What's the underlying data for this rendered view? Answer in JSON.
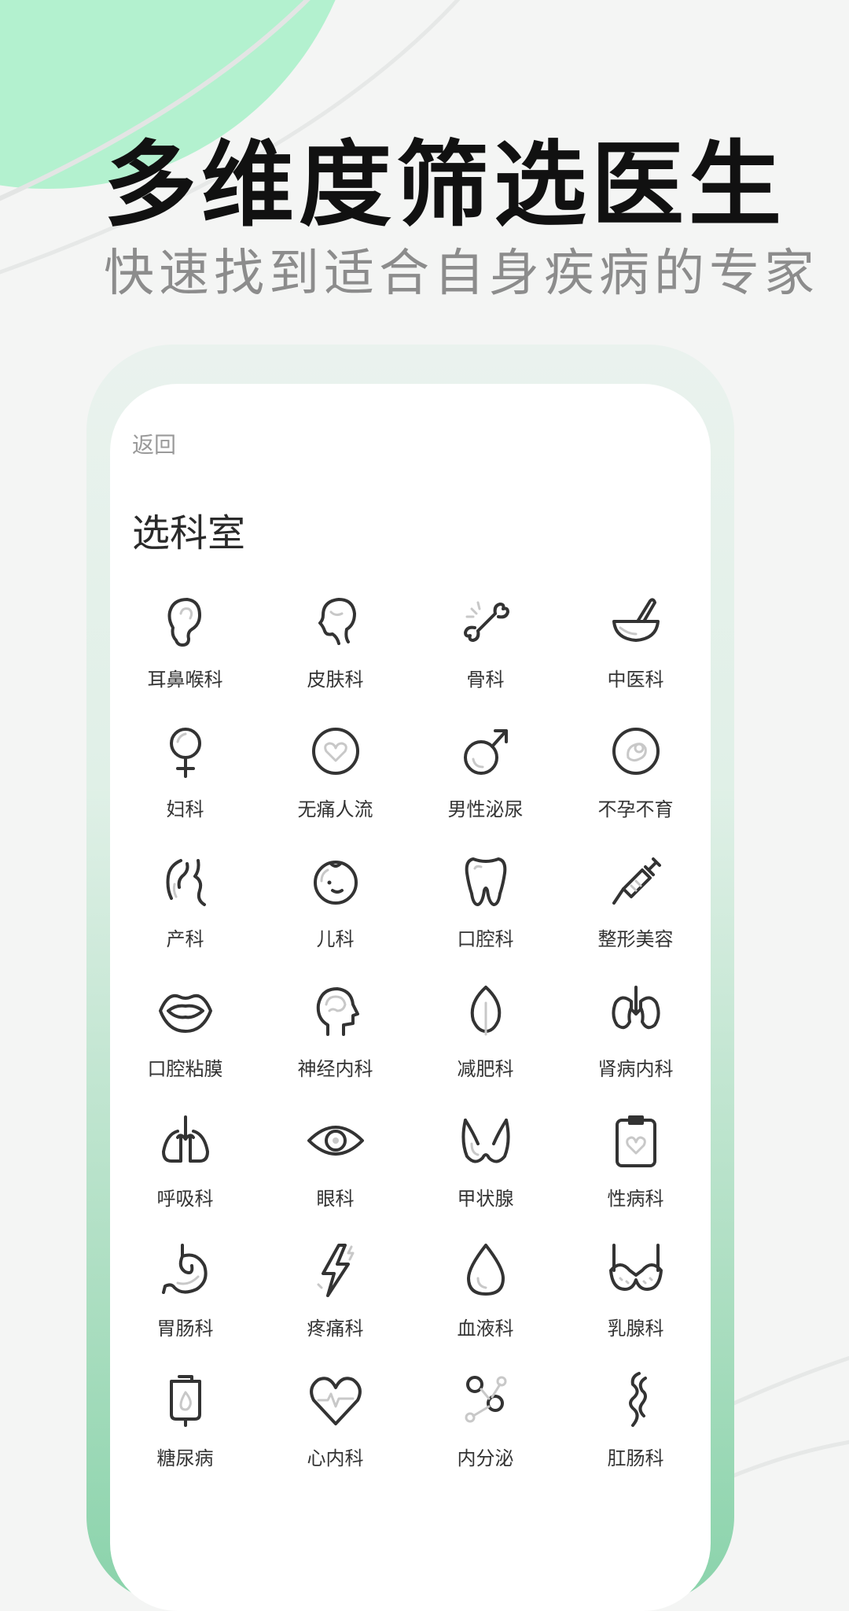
{
  "headline": "多维度筛选医生",
  "subline": "快速找到适合自身疾病的专家",
  "phone": {
    "back_label": "返回",
    "title": "选科室"
  },
  "departments": [
    {
      "label": "耳鼻喉科",
      "icon": "ear-icon"
    },
    {
      "label": "皮肤科",
      "icon": "face-profile-icon"
    },
    {
      "label": "骨科",
      "icon": "bone-icon"
    },
    {
      "label": "中医科",
      "icon": "mortar-pestle-icon"
    },
    {
      "label": "妇科",
      "icon": "female-symbol-icon"
    },
    {
      "label": "无痛人流",
      "icon": "heart-circle-icon"
    },
    {
      "label": "男性泌尿",
      "icon": "male-symbol-icon"
    },
    {
      "label": "不孕不育",
      "icon": "baby-circle-icon"
    },
    {
      "label": "产科",
      "icon": "pregnancy-icon"
    },
    {
      "label": "儿科",
      "icon": "baby-face-icon"
    },
    {
      "label": "口腔科",
      "icon": "tooth-icon"
    },
    {
      "label": "整形美容",
      "icon": "syringe-icon"
    },
    {
      "label": "口腔粘膜",
      "icon": "lips-icon"
    },
    {
      "label": "神经内科",
      "icon": "head-brain-icon"
    },
    {
      "label": "减肥科",
      "icon": "leaf-icon"
    },
    {
      "label": "肾病内科",
      "icon": "kidneys-icon"
    },
    {
      "label": "呼吸科",
      "icon": "lungs-icon"
    },
    {
      "label": "眼科",
      "icon": "eye-icon"
    },
    {
      "label": "甲状腺",
      "icon": "thyroid-icon"
    },
    {
      "label": "性病科",
      "icon": "clipboard-heart-icon"
    },
    {
      "label": "胃肠科",
      "icon": "stomach-icon"
    },
    {
      "label": "疼痛科",
      "icon": "lightning-icon"
    },
    {
      "label": "血液科",
      "icon": "blood-drop-icon"
    },
    {
      "label": "乳腺科",
      "icon": "bra-icon"
    },
    {
      "label": "糖尿病",
      "icon": "iv-bag-icon"
    },
    {
      "label": "心内科",
      "icon": "heart-pulse-icon"
    },
    {
      "label": "内分泌",
      "icon": "nodes-icon"
    },
    {
      "label": "肛肠科",
      "icon": "intestine-icon"
    }
  ],
  "colors": {
    "accent": "#8ad3ab",
    "blob": "#b3f1cf",
    "background": "#f4f5f4"
  }
}
